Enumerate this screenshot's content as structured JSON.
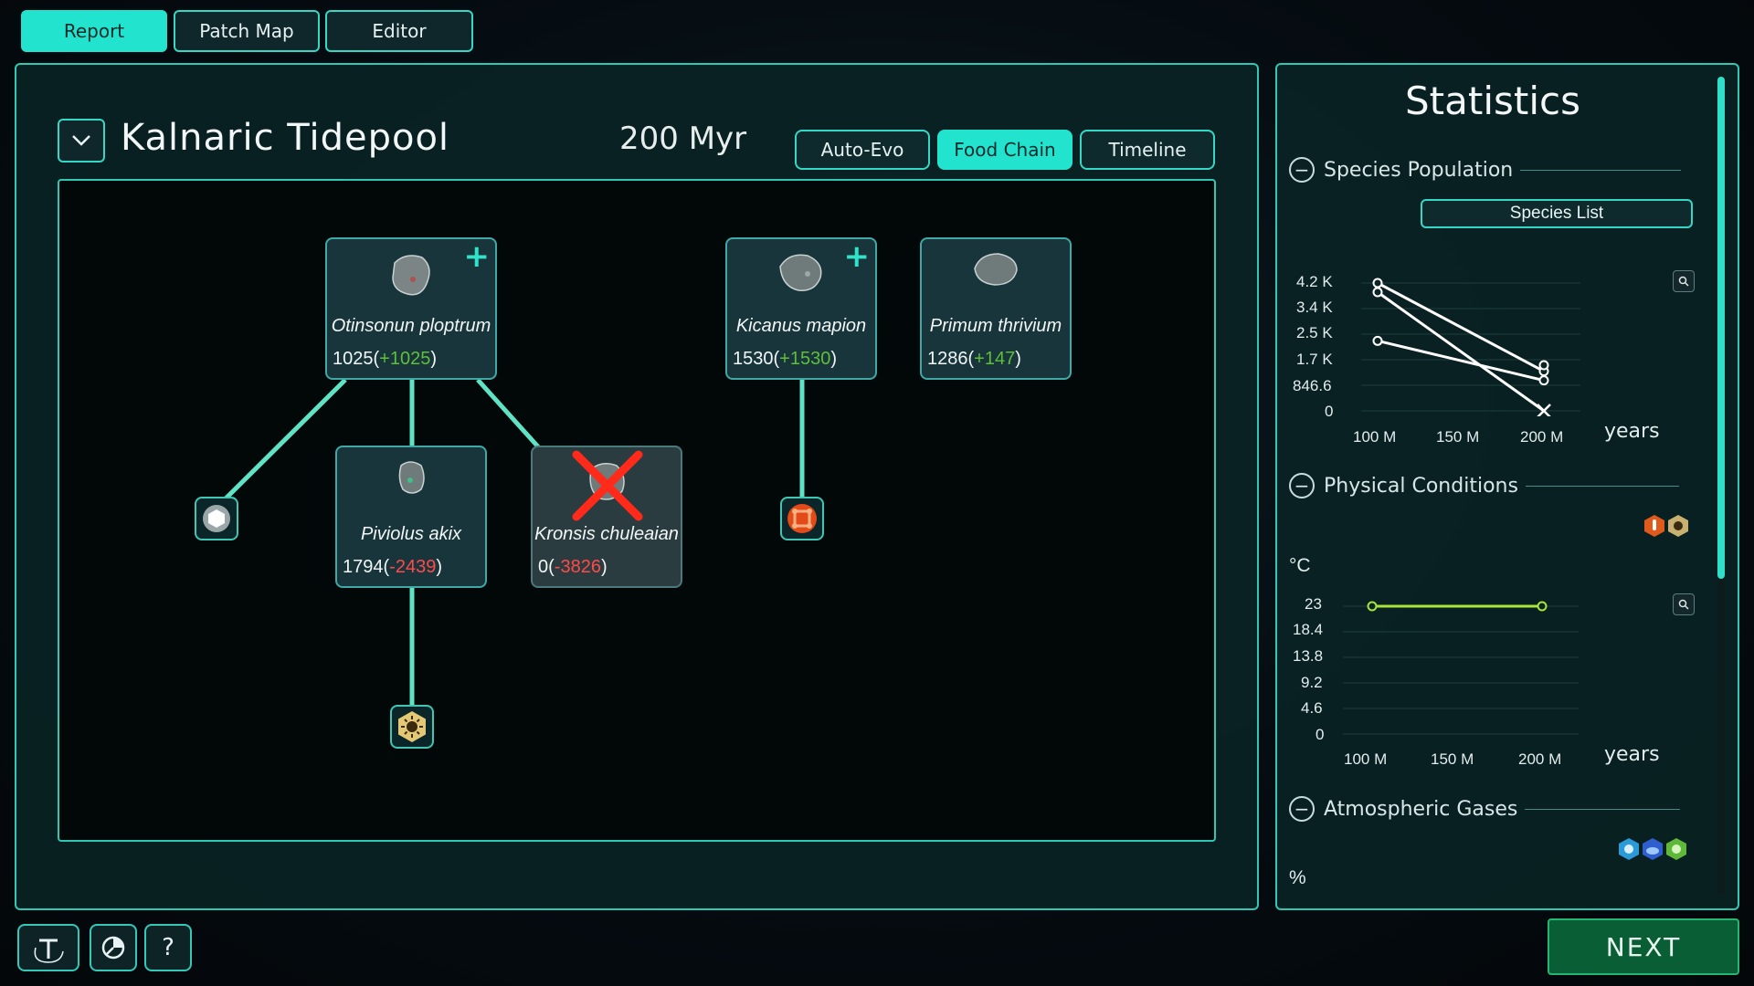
{
  "top_tabs": [
    {
      "label": "Report",
      "active": true
    },
    {
      "label": "Patch Map",
      "active": false
    },
    {
      "label": "Editor",
      "active": false
    }
  ],
  "patch": {
    "name": "Kalnaric Tidepool",
    "time": "200 Myr"
  },
  "view_tabs": [
    {
      "label": "Auto-Evo",
      "active": false
    },
    {
      "label": "Food Chain",
      "active": true
    },
    {
      "label": "Timeline",
      "active": false
    }
  ],
  "species": [
    {
      "name": "Otinsonun ploptrum",
      "population": "1025",
      "change": "+1025",
      "new": true,
      "extinct": false
    },
    {
      "name": "Kicanus mapion",
      "population": "1530",
      "change": "+1530",
      "new": true,
      "extinct": false
    },
    {
      "name": "Primum thrivium",
      "population": "1286",
      "change": "+147",
      "new": false,
      "extinct": false
    },
    {
      "name": "Piviolus akix",
      "population": "1794",
      "change": "-2439",
      "new": false,
      "extinct": false
    },
    {
      "name": "Kronsis chuleaian",
      "population": "0",
      "change": "-3826",
      "new": false,
      "extinct": true
    }
  ],
  "compounds": [
    {
      "icon": "glucose-icon"
    },
    {
      "icon": "iron-icon"
    },
    {
      "icon": "sunlight-icon"
    }
  ],
  "statistics": {
    "title": "Statistics",
    "species_population": {
      "heading": "Species Population",
      "button": "Species List",
      "y_ticks": [
        "4.2 K",
        "3.4 K",
        "2.5 K",
        "1.7 K",
        "846.6",
        "0"
      ],
      "x_ticks": [
        "100 M",
        "150 M",
        "200 M"
      ],
      "unit": "years"
    },
    "physical_conditions": {
      "heading": "Physical Conditions",
      "y_unit": "°C",
      "y_ticks": [
        "23",
        "18.4",
        "13.8",
        "9.2",
        "4.6",
        "0"
      ],
      "x_ticks": [
        "100 M",
        "150 M",
        "200 M"
      ],
      "unit": "years"
    },
    "atmospheric_gases": {
      "heading": "Atmospheric Gases",
      "y_unit": "%"
    }
  },
  "chart_data": [
    {
      "type": "line",
      "x": [
        100,
        200
      ],
      "ylim": [
        0,
        4200
      ],
      "series": [
        {
          "values": [
            4200,
            1300
          ],
          "color": "#ffffff"
        },
        {
          "values": [
            3900,
            0
          ],
          "color": "#ffffff"
        },
        {
          "values": [
            2300,
            1000
          ],
          "color": "#ffffff"
        },
        {
          "values": [
            null,
            1500
          ],
          "color": "#ffffff"
        }
      ]
    },
    {
      "type": "line",
      "x": [
        100,
        200
      ],
      "ylim": [
        0,
        23
      ],
      "series": [
        {
          "values": [
            23,
            23
          ],
          "color": "#a8e43a"
        }
      ]
    }
  ],
  "bottom": {
    "help_label": "?",
    "next_label": "NEXT"
  },
  "colors": {
    "accent": "#22e3ce",
    "positive": "#5fbf3a",
    "negative": "#ff4a4a",
    "next": "#0a5e36"
  }
}
